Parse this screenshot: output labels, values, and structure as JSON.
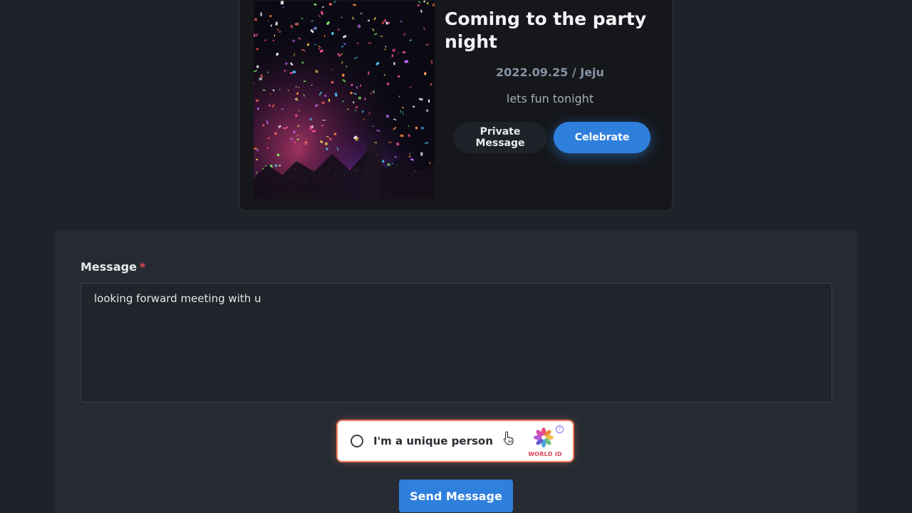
{
  "event": {
    "title": "Coming to the party night",
    "meta": "2022.09.25 / Jeju",
    "description": "lets fun tonight",
    "private_message_label": "Private Message",
    "celebrate_label": "Celebrate"
  },
  "form": {
    "message_label": "Message",
    "required_mark": "*",
    "message_value": "looking forward meeting with u"
  },
  "worldid": {
    "label": "I'm a unique person",
    "brand": "WORLD ID",
    "help_glyph": "?",
    "logo_icon": "worldid-flower-icon"
  },
  "send_label": "Send Message",
  "colors": {
    "accent": "#2f7fdd",
    "page_bg": "#1e2229",
    "panel_bg": "#262b33",
    "card_bg": "#15171b",
    "required": "#e5484d",
    "worldid_border": "#f07a5a"
  }
}
